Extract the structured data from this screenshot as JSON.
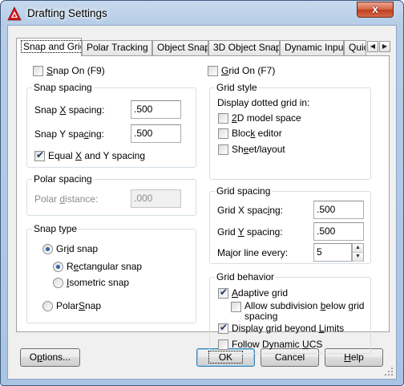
{
  "window": {
    "title": "Drafting Settings",
    "close_symbol": "x"
  },
  "tabs": [
    {
      "label": "Snap and Grid",
      "active": true
    },
    {
      "label": "Polar Tracking"
    },
    {
      "label": "Object Snap"
    },
    {
      "label": "3D Object Snap"
    },
    {
      "label": "Dynamic Input"
    },
    {
      "label": "Quic"
    }
  ],
  "tab_scroll": {
    "left": "◀",
    "right": "▶"
  },
  "snap": {
    "snap_on": {
      "pre": "",
      "key": "S",
      "post": "nap On (F9)",
      "checked": false
    },
    "spacing": {
      "legend": "Snap spacing",
      "x_label": {
        "pre": "Snap ",
        "key": "X",
        "post": " spacing:"
      },
      "x_value": ".500",
      "y_label": {
        "pre": "Snap Y spa",
        "key": "c",
        "post": "ing:"
      },
      "y_value": ".500",
      "equal": {
        "pre": "Equal ",
        "key": "X",
        "post": " and Y spacing",
        "checked": true
      }
    },
    "polar": {
      "legend": "Polar spacing",
      "distance_label": {
        "pre": "Polar ",
        "key": "d",
        "post": "istance:"
      },
      "distance_value": ".000"
    },
    "type": {
      "legend": "Snap type",
      "grid_snap": {
        "pre": "Gr",
        "key": "i",
        "post": "d snap",
        "checked": true
      },
      "rectangular": {
        "pre": "R",
        "key": "e",
        "post": "ctangular snap",
        "checked": true
      },
      "isometric": {
        "pre": "",
        "key": "I",
        "post": "sometric snap",
        "checked": false
      },
      "polar_snap": {
        "pre": "Polar",
        "key": "S",
        "post": "nap",
        "checked": false
      }
    }
  },
  "grid": {
    "grid_on": {
      "pre": "",
      "key": "G",
      "post": "rid On (F7)",
      "checked": false
    },
    "style": {
      "legend": "Grid style",
      "caption": "Display dotted grid in:",
      "model": {
        "pre": "",
        "key": "2",
        "post": "D model space",
        "checked": false
      },
      "block": {
        "pre": "Bloc",
        "key": "k",
        "post": " editor",
        "checked": false
      },
      "sheet": {
        "pre": "Sh",
        "key": "e",
        "post": "et/layout",
        "checked": false
      }
    },
    "spacing": {
      "legend": "Grid spacing",
      "x_label": {
        "pre": "Grid X spac",
        "key": "i",
        "post": "ng:"
      },
      "x_value": ".500",
      "y_label": {
        "pre": "Grid ",
        "key": "Y",
        "post": " spacing:"
      },
      "y_value": ".500",
      "major_label": {
        "pre": "Ma",
        "key": "j",
        "post": "or line every:"
      },
      "major_value": "5",
      "spin_up": "▲",
      "spin_down": "▼"
    },
    "behavior": {
      "legend": "Grid behavior",
      "adaptive": {
        "pre": "",
        "key": "A",
        "post": "daptive grid",
        "checked": true
      },
      "subdivision": {
        "pre": "Allow subdivision ",
        "key": "b",
        "post": "elow grid",
        "line2": "spacing",
        "checked": false
      },
      "beyond": {
        "pre": "Display grid beyond ",
        "key": "L",
        "post": "imits",
        "checked": true
      },
      "follow": {
        "pre": "Follow Dynamic ",
        "key": "U",
        "post": "CS",
        "checked": false
      }
    }
  },
  "buttons": {
    "options": {
      "pre": "O",
      "key": "p",
      "post": "tions..."
    },
    "ok": "OK",
    "cancel": "Cancel",
    "help": {
      "pre": "",
      "key": "H",
      "post": "elp"
    }
  },
  "icons": {
    "app": "autocad-logo-icon",
    "grip": "resize-grip-icon"
  },
  "colors": {
    "accent_red": "#d4171e",
    "title_gradient": "#b6cde8",
    "close_red": "#c0401e"
  }
}
